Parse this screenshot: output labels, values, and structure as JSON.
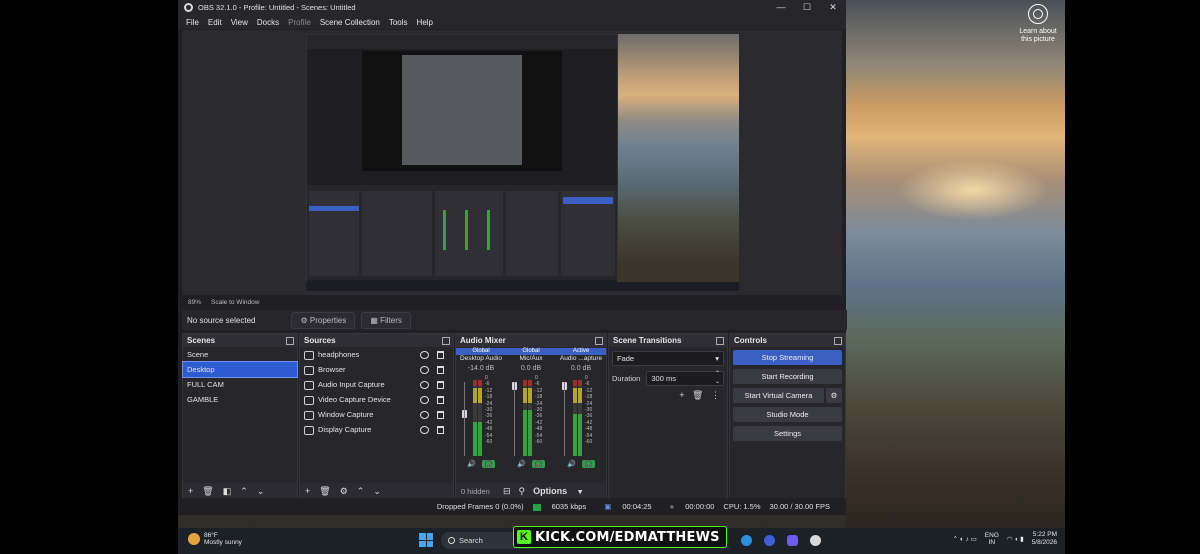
{
  "desktop": {
    "learn_about": "Learn about this picture"
  },
  "obs": {
    "title": "OBS 32.1.0 - Profile: Untitled - Scenes: Untitled",
    "window_buttons": [
      "—",
      "☐",
      "✕"
    ],
    "menu": [
      "File",
      "Edit",
      "View",
      "Docks",
      "Profile",
      "Scene Collection",
      "Tools",
      "Help"
    ],
    "preview_toolbar": [
      "89%",
      "Scale to Window"
    ],
    "source_bar": {
      "label": "No source selected",
      "properties": "Properties",
      "filters": "Filters"
    },
    "scenes": {
      "title": "Scenes",
      "items": [
        "Scene",
        "Desktop",
        "FULL CAM",
        "GAMBLE"
      ],
      "selected_index": 1
    },
    "sources": {
      "title": "Sources",
      "items": [
        "headphones",
        "Browser",
        "Audio Input Capture",
        "Video Capture Device",
        "Window Capture",
        "Display Capture"
      ]
    },
    "audio_mixer": {
      "title": "Audio Mixer",
      "channels": [
        {
          "tag": "Global",
          "name": "Desktop Audio",
          "db": "-14.0 dB",
          "level": 0.45,
          "fader": 0.55
        },
        {
          "tag": "Global",
          "name": "Mic/Aux",
          "db": "0.0 dB",
          "level": 0.6,
          "fader": 0.95
        },
        {
          "tag": "Active",
          "name": "Audio ...apture",
          "db": "0.0 dB",
          "level": 0.55,
          "fader": 0.95
        }
      ],
      "ticks": [
        "0",
        "-6",
        "-12",
        "-18",
        "-24",
        "-30",
        "-36",
        "-42",
        "-48",
        "-54",
        "-60"
      ],
      "hidden": "0 hidden",
      "options": "Options"
    },
    "transitions": {
      "title": "Scene Transitions",
      "type": "Fade",
      "duration_label": "Duration",
      "duration": "300 ms"
    },
    "controls": {
      "title": "Controls",
      "buttons": [
        "Stop Streaming",
        "Start Recording",
        "Start Virtual Camera",
        "Studio Mode",
        "Settings"
      ]
    },
    "status": {
      "dropped": "Dropped Frames 0 (0.0%)",
      "kbps": "6035 kbps",
      "stream_time": "00:04:25",
      "rec_time": "00:00:00",
      "cpu": "CPU: 1.5%",
      "fps": "30.00 / 30.00 FPS"
    }
  },
  "taskbar": {
    "weather_temp": "86°F",
    "weather_desc": "Mostly sunny",
    "search": "Search",
    "kick": "KICK.COM/EDMATTHEWS",
    "lang": "ENG",
    "region": "IN",
    "time": "5:22 PM",
    "date": "5/8/2026"
  },
  "colors": {
    "accent": "#3c5fc4",
    "kick_green": "#53fc18"
  }
}
